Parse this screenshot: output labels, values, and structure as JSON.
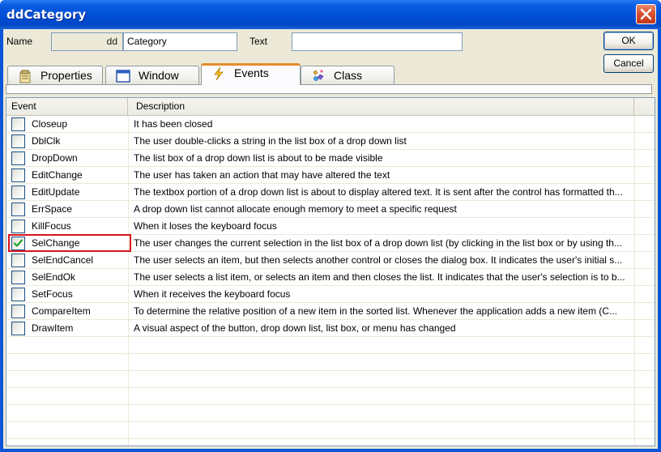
{
  "window": {
    "title": "ddCategory"
  },
  "header": {
    "name_label": "Name",
    "name_prefix": "dd",
    "name_value": "Category",
    "text_label": "Text",
    "text_value": "",
    "ok_label": "OK",
    "cancel_label": "Cancel"
  },
  "tabs": [
    {
      "label": "Properties",
      "icon": "properties-icon",
      "active": false
    },
    {
      "label": "Window",
      "icon": "window-icon",
      "active": false
    },
    {
      "label": "Events",
      "icon": "lightning-icon",
      "active": true
    },
    {
      "label": "Class",
      "icon": "class-icon",
      "active": false
    }
  ],
  "grid": {
    "columns": [
      "Event",
      "Description"
    ],
    "rows": [
      {
        "event": "Closeup",
        "checked": false,
        "description": "It has been closed"
      },
      {
        "event": "DblClk",
        "checked": false,
        "description": "The user double-clicks a string in the list box of a drop down list"
      },
      {
        "event": "DropDown",
        "checked": false,
        "description": "The list box of a drop down list is about to be made visible"
      },
      {
        "event": "EditChange",
        "checked": false,
        "description": "The user has taken an action that may have altered the text"
      },
      {
        "event": "EditUpdate",
        "checked": false,
        "description": "The textbox portion of a drop down list is about to display altered text. It is sent after the control has formatted th..."
      },
      {
        "event": "ErrSpace",
        "checked": false,
        "description": "A drop down list cannot allocate enough memory to meet a specific request"
      },
      {
        "event": "KillFocus",
        "checked": false,
        "description": "When it loses the keyboard focus"
      },
      {
        "event": "SelChange",
        "checked": true,
        "description": "The user changes the current selection in the list box of a drop down list (by clicking in the list box or by using th..."
      },
      {
        "event": "SelEndCancel",
        "checked": false,
        "description": "The user selects an item, but then selects another control or closes the dialog box. It indicates the user's initial s..."
      },
      {
        "event": "SelEndOk",
        "checked": false,
        "description": "The user selects a list item, or selects an item and then closes the list. It indicates that the user's selection is to b..."
      },
      {
        "event": "SetFocus",
        "checked": false,
        "description": "When it receives the keyboard focus"
      },
      {
        "event": "CompareItem",
        "checked": false,
        "description": "To determine the relative position of a new item in the sorted list. Whenever the application adds a new item (C..."
      },
      {
        "event": "DrawItem",
        "checked": false,
        "description": "A visual aspect of the button, drop down list, list box, or menu has changed"
      }
    ]
  },
  "colors": {
    "titlebar": "#0050d8",
    "dialog_bg": "#ece9d8",
    "active_tab_accent": "#e68b2c",
    "highlight_border": "#d9141a",
    "check_mark": "#21a121"
  }
}
